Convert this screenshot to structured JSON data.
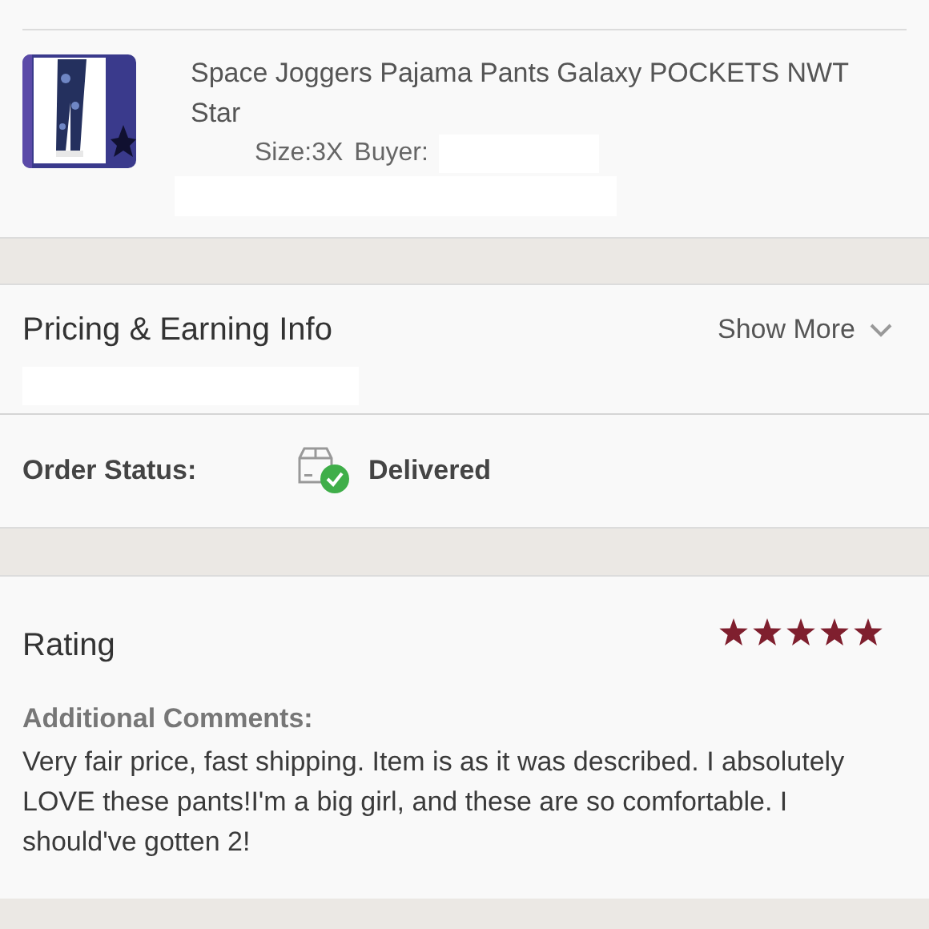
{
  "item": {
    "title": "Space Joggers Pajama Pants Galaxy POCKETS NWT Star",
    "size": "Size:3X",
    "buyer_label": "Buyer:"
  },
  "pricing": {
    "title": "Pricing & Earning Info",
    "toggle": "Show More",
    "expanded": false
  },
  "order_status": {
    "label": "Order Status:",
    "value": "Delivered"
  },
  "rating": {
    "title": "Rating",
    "stars": 5,
    "comments_label": "Additional Comments:",
    "comments": "Very fair price, fast shipping. Item is as it was described. I absolutely LOVE these pants!I'm a big girl, and these are so comfortable. I should've gotten 2!"
  }
}
